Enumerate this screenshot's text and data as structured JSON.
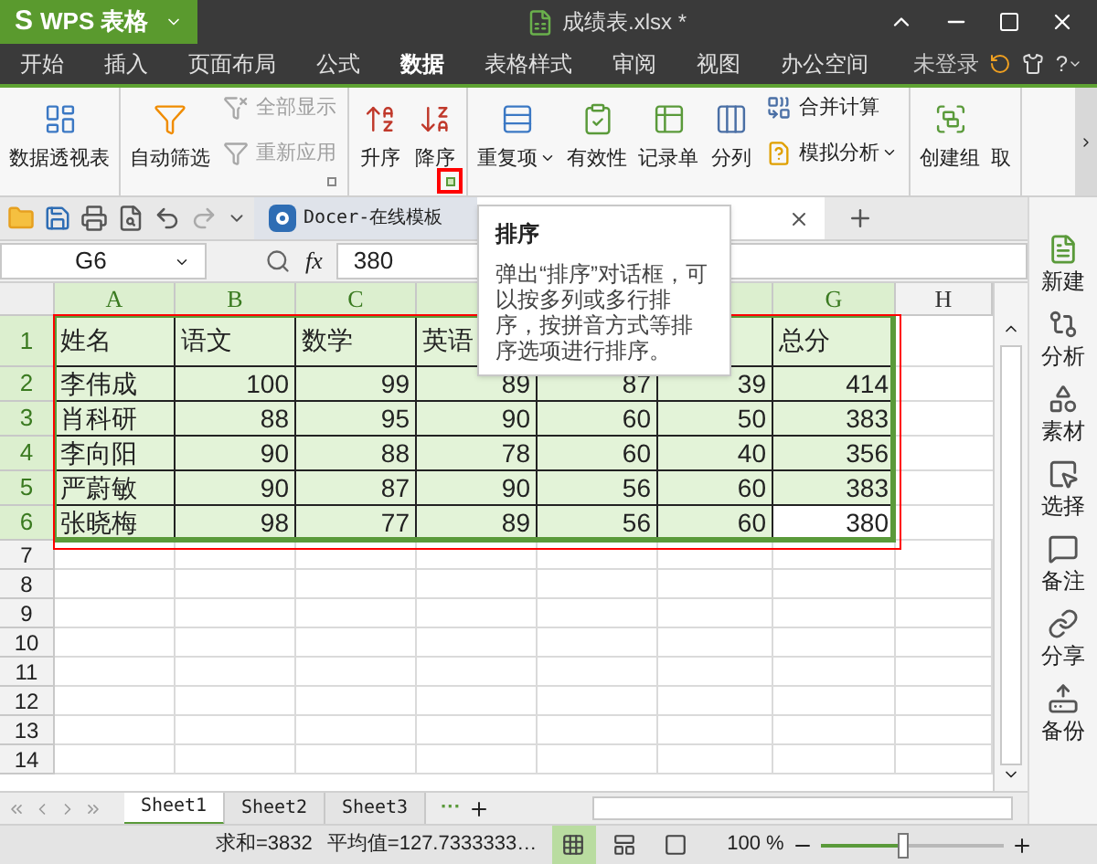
{
  "app_button": {
    "logo": "S",
    "label": "WPS 表格"
  },
  "window": {
    "title": "成绩表.xlsx *"
  },
  "menu": {
    "tabs": [
      {
        "label": "开始",
        "selected": false
      },
      {
        "label": "插入",
        "selected": false
      },
      {
        "label": "页面布局",
        "selected": false
      },
      {
        "label": "公式",
        "selected": false
      },
      {
        "label": "数据",
        "selected": true
      },
      {
        "label": "表格样式",
        "selected": false
      },
      {
        "label": "审阅",
        "selected": false
      },
      {
        "label": "视图",
        "selected": false
      },
      {
        "label": "办公空间",
        "selected": false
      }
    ],
    "account": "未登录",
    "help": "?"
  },
  "ribbon": {
    "groups": [
      {
        "items": [
          {
            "kind": "large",
            "label": "数据透视表",
            "disabled": false
          }
        ]
      },
      {
        "launcher": {
          "highlighted": false
        },
        "items": [
          {
            "kind": "large",
            "label": "自动筛选",
            "disabled": false
          },
          {
            "kind": "small",
            "label": "全部显示",
            "disabled": true
          },
          {
            "kind": "small",
            "label": "重新应用",
            "disabled": true
          }
        ]
      },
      {
        "launcher": {
          "highlighted": true
        },
        "items": [
          {
            "kind": "large",
            "label": "升序",
            "disabled": false
          },
          {
            "kind": "large",
            "label": "降序",
            "disabled": false
          }
        ]
      },
      {
        "items": [
          {
            "kind": "large",
            "label": "重复项",
            "disabled": false,
            "dropdown": true
          },
          {
            "kind": "large",
            "label": "有效性",
            "disabled": false
          },
          {
            "kind": "large",
            "label": "记录单",
            "disabled": false
          },
          {
            "kind": "large",
            "label": "分列",
            "disabled": false
          },
          {
            "kind": "small",
            "label": "合并计算",
            "disabled": false
          },
          {
            "kind": "small",
            "label": "模拟分析",
            "disabled": false,
            "dropdown": true
          }
        ]
      },
      {
        "items": [
          {
            "kind": "large",
            "label": "创建组",
            "disabled": false
          },
          {
            "kind": "large",
            "label": "取",
            "disabled": false
          }
        ]
      }
    ]
  },
  "doc_tabs": [
    {
      "label": "Docer-在线模板",
      "selected": false
    },
    {
      "selected": true
    }
  ],
  "formula_bar": {
    "cell_ref": "G6",
    "function_label": "fx",
    "value": "380"
  },
  "sheet": {
    "columns": [
      {
        "label": "A",
        "selected": true
      },
      {
        "label": "B",
        "selected": true
      },
      {
        "label": "C",
        "selected": true
      },
      {
        "selected": true
      },
      {},
      {
        "selected": true
      },
      {
        "label": "G",
        "selected": true
      },
      {
        "label": "H",
        "selected": false
      }
    ],
    "rows": [
      {
        "header": "1",
        "selected": true,
        "cells": [
          {
            "text": "姓名",
            "active": false
          },
          {
            "text": "语文",
            "active": false
          },
          {
            "text": "数学",
            "active": false
          },
          {
            "text": "英语",
            "active": false
          },
          {},
          {
            "active": false
          },
          {
            "text": "总分",
            "active": false
          }
        ]
      },
      {
        "header": "2",
        "selected": true,
        "cells": [
          {
            "text": "李伟成",
            "active": false
          },
          {
            "text": "100",
            "active": false
          },
          {
            "text": "99",
            "active": false
          },
          {
            "text": "89",
            "active": false
          },
          {
            "text": "87",
            "active": false
          },
          {
            "text": "39",
            "active": false
          },
          {
            "text": "414",
            "active": false
          }
        ]
      },
      {
        "header": "3",
        "selected": true,
        "cells": [
          {
            "text": "肖科研",
            "active": false
          },
          {
            "text": "88",
            "active": false
          },
          {
            "text": "95",
            "active": false
          },
          {
            "text": "90",
            "active": false
          },
          {
            "text": "60",
            "active": false
          },
          {
            "text": "50",
            "active": false
          },
          {
            "text": "383",
            "active": false
          }
        ]
      },
      {
        "header": "4",
        "selected": true,
        "cells": [
          {
            "text": "李向阳",
            "active": false
          },
          {
            "text": "90",
            "active": false
          },
          {
            "text": "88",
            "active": false
          },
          {
            "text": "78",
            "active": false
          },
          {
            "text": "60",
            "active": false
          },
          {
            "text": "40",
            "active": false
          },
          {
            "text": "356",
            "active": false
          }
        ]
      },
      {
        "header": "5",
        "selected": true,
        "cells": [
          {
            "text": "严蔚敏",
            "active": false
          },
          {
            "text": "90",
            "active": false
          },
          {
            "text": "87",
            "active": false
          },
          {
            "text": "90",
            "active": false
          },
          {
            "text": "56",
            "active": false
          },
          {
            "text": "60",
            "active": false
          },
          {
            "text": "383",
            "active": false
          }
        ]
      },
      {
        "header": "6",
        "selected": true,
        "cells": [
          {
            "text": "张晓梅",
            "active": false
          },
          {
            "text": "98",
            "active": false
          },
          {
            "text": "77",
            "active": false
          },
          {
            "text": "89",
            "active": false
          },
          {
            "text": "56",
            "active": false
          },
          {
            "text": "60",
            "active": false
          },
          {
            "text": "380",
            "active": true
          }
        ]
      }
    ],
    "empty_rows": [
      "7",
      "8",
      "9",
      "10",
      "11",
      "12",
      "13",
      "14"
    ]
  },
  "sheet_tabs": [
    {
      "label": "Sheet1",
      "selected": true
    },
    {
      "label": "Sheet2",
      "selected": false
    },
    {
      "label": "Sheet3",
      "selected": false
    }
  ],
  "more_tabs": "···",
  "side_panel": {
    "items": [
      {
        "label": "新建"
      },
      {
        "label": "分析"
      },
      {
        "label": "素材"
      },
      {
        "label": "选择"
      },
      {
        "label": "备注"
      },
      {
        "label": "分享"
      },
      {
        "label": "备份"
      }
    ]
  },
  "status_bar": {
    "sum": "求和=3832",
    "average": "平均值=127.7333333…",
    "views": [
      {
        "selected": true
      },
      {
        "selected": false
      },
      {
        "selected": false
      }
    ],
    "zoom": "100 %",
    "zoom_slider": {
      "level": 0.45
    }
  },
  "tooltip": {
    "title": "排序",
    "body": "弹出“排序”对话框，可以按多列或多行排序，按拼音方式等排序选项进行排序。"
  }
}
